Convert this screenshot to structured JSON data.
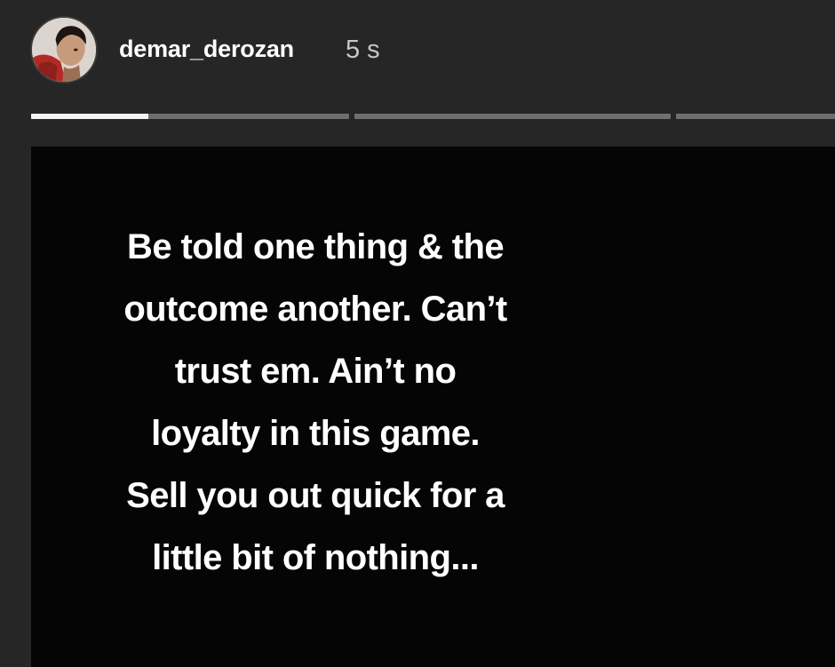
{
  "header": {
    "username": "demar_derozan",
    "timestamp": "5 s",
    "avatar_icon": "profile-photo"
  },
  "progress": {
    "segments": [
      {
        "label": "story-1",
        "progress": 0.37
      },
      {
        "label": "story-2",
        "progress": 0
      },
      {
        "label": "story-3",
        "progress": 0
      }
    ],
    "active_color": "#f4f4f4",
    "inactive_color": "#6f6f6f"
  },
  "story": {
    "background": "#050505",
    "lines": [
      "Be told one thing & the",
      "outcome another. Can’t",
      "trust em. Ain’t no",
      "loyalty in this game.",
      "Sell you out quick for a",
      "little bit of nothing..."
    ]
  }
}
